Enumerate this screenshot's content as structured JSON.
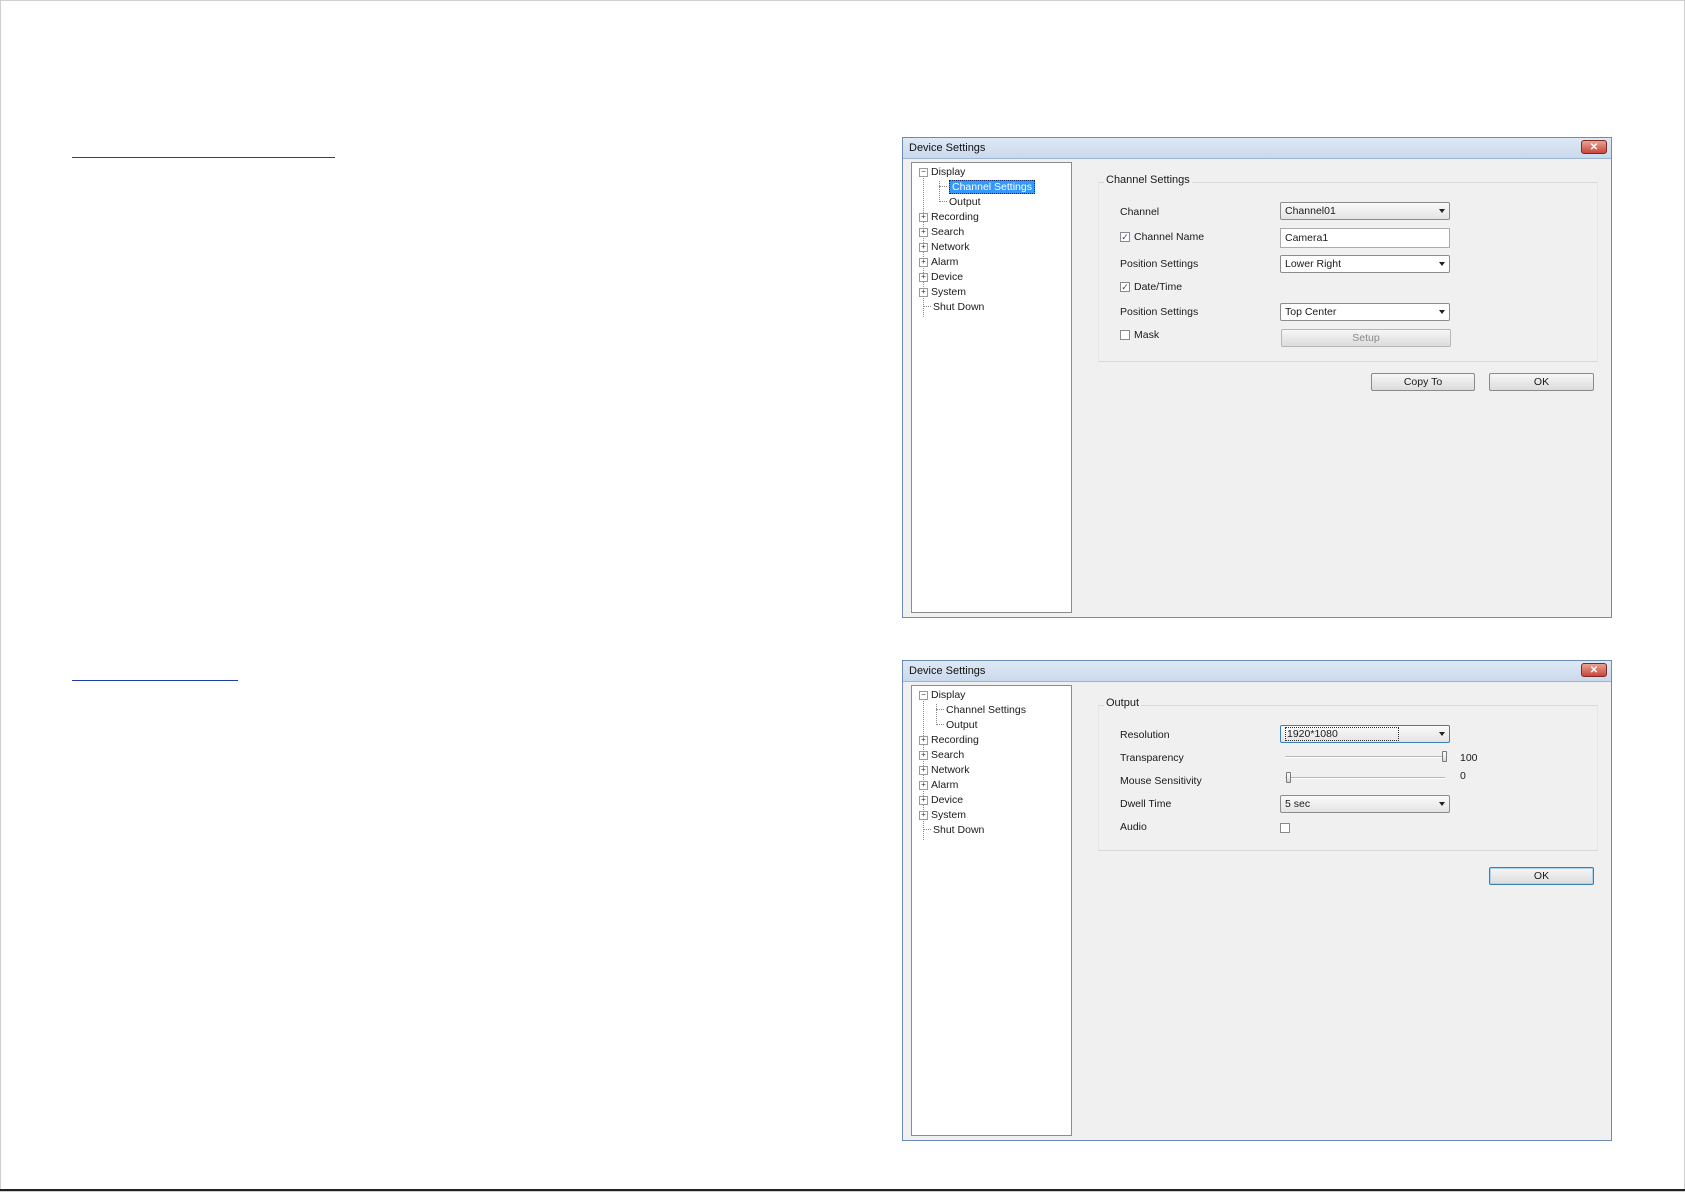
{
  "dialog1": {
    "title": "Device Settings",
    "close_glyph": "✕",
    "tree": {
      "items": [
        {
          "label": "Display",
          "expander": "−"
        },
        {
          "label": "Channel Settings"
        },
        {
          "label": "Output"
        },
        {
          "label": "Recording",
          "expander": "+"
        },
        {
          "label": "Search",
          "expander": "+"
        },
        {
          "label": "Network",
          "expander": "+"
        },
        {
          "label": "Alarm",
          "expander": "+"
        },
        {
          "label": "Device",
          "expander": "+"
        },
        {
          "label": "System",
          "expander": "+"
        },
        {
          "label": "Shut Down"
        }
      ],
      "selected": "Channel Settings"
    },
    "group_title": "Channel Settings",
    "fields": {
      "channel_label": "Channel",
      "channel_value": "Channel01",
      "channel_name_label": "Channel Name",
      "channel_name_checked": "✓",
      "channel_name_value": "Camera1",
      "position1_label": "Position Settings",
      "position1_value": "Lower Right",
      "datetime_label": "Date/Time",
      "datetime_checked": "✓",
      "position2_label": "Position Settings",
      "position2_value": "Top Center",
      "mask_label": "Mask",
      "setup_button": "Setup"
    },
    "buttons": {
      "copy_to": "Copy To",
      "ok": "OK"
    }
  },
  "dialog2": {
    "title": "Device Settings",
    "close_glyph": "✕",
    "tree": {
      "items": [
        {
          "label": "Display",
          "expander": "−"
        },
        {
          "label": "Channel Settings"
        },
        {
          "label": "Output"
        },
        {
          "label": "Recording",
          "expander": "+"
        },
        {
          "label": "Search",
          "expander": "+"
        },
        {
          "label": "Network",
          "expander": "+"
        },
        {
          "label": "Alarm",
          "expander": "+"
        },
        {
          "label": "Device",
          "expander": "+"
        },
        {
          "label": "System",
          "expander": "+"
        },
        {
          "label": "Shut Down"
        }
      ]
    },
    "group_title": "Output",
    "fields": {
      "resolution_label": "Resolution",
      "resolution_value": "1920*1080",
      "transparency_label": "Transparency",
      "transparency_value": "100",
      "mouse_label": "Mouse Sensitivity",
      "mouse_value": "0",
      "dwell_label": "Dwell Time",
      "dwell_value": "5 sec",
      "audio_label": "Audio"
    },
    "buttons": {
      "ok": "OK"
    }
  },
  "colors": {
    "selection": "#3399ff",
    "heading_underline": "#1f3e9e",
    "dialog_border": "#6b8db5"
  }
}
